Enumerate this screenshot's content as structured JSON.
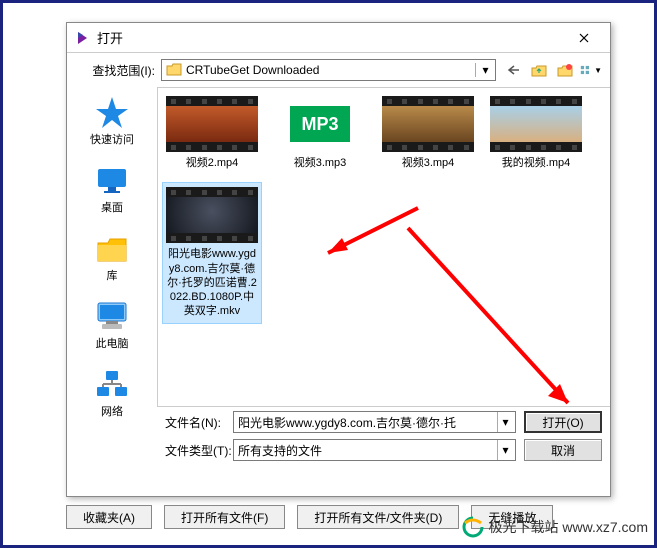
{
  "dialog": {
    "title": "打开",
    "lookin_label": "查找范围(I):",
    "current_folder": "CRTubeGet Downloaded",
    "filename_label": "文件名(N):",
    "filename_value": "阳光电影www.ygdy8.com.吉尔莫·德尔·托",
    "filetype_label": "文件类型(T):",
    "filetype_value": "所有支持的文件",
    "open_button": "打开(O)",
    "cancel_button": "取消"
  },
  "places": [
    {
      "label": "快速访问",
      "name": "quick-access"
    },
    {
      "label": "桌面",
      "name": "desktop"
    },
    {
      "label": "库",
      "name": "libraries"
    },
    {
      "label": "此电脑",
      "name": "this-pc"
    },
    {
      "label": "网络",
      "name": "network"
    }
  ],
  "files": {
    "row1": [
      {
        "label": "视频2.mp4",
        "type": "video"
      },
      {
        "label": "视频3.mp3",
        "type": "mp3"
      },
      {
        "label": "视频3.mp4",
        "type": "video"
      },
      {
        "label": "我的视频.mp4",
        "type": "video"
      }
    ],
    "selected": {
      "label": "阳光电影www.ygdy8.com.吉尔莫·德尔·托罗的匹诺曹.2022.BD.1080P.中英双字.mkv",
      "type": "video"
    }
  },
  "mp3_badge": "MP3",
  "bottom_buttons": {
    "favorites": "收藏夹(A)",
    "open_all_files": "打开所有文件(F)",
    "open_all_folders": "打开所有文件/文件夹(D)",
    "seamless_play": "无缝播放"
  },
  "watermark": "极光下载站 www.xz7.com"
}
